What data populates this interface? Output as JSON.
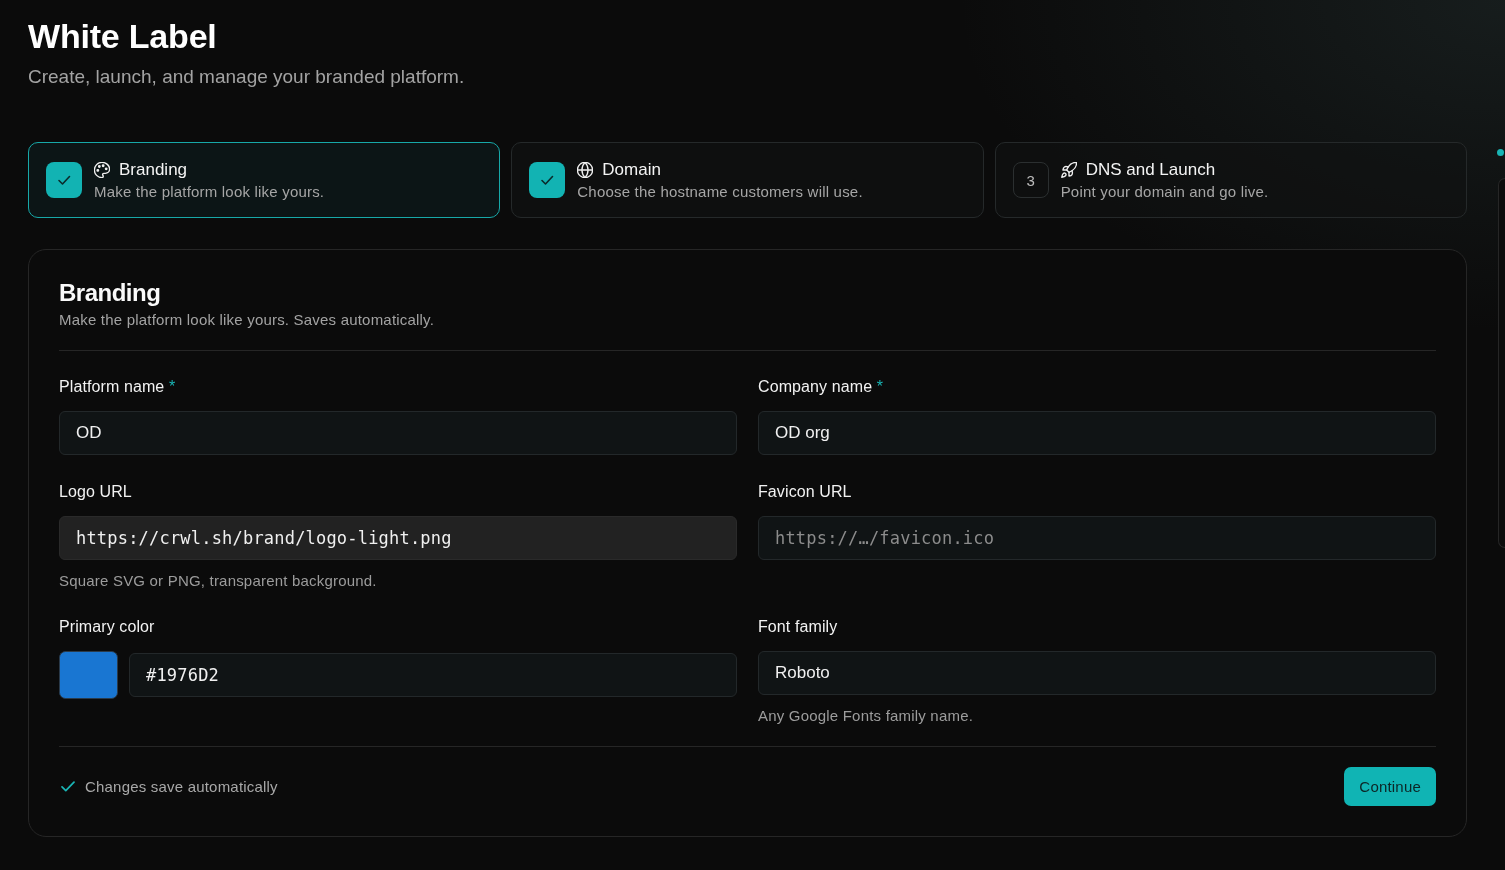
{
  "header": {
    "title": "White Label",
    "subtitle": "Create, launch, and manage your branded platform."
  },
  "steps": [
    {
      "title": "Branding",
      "description": "Make the platform look like yours.",
      "selected": true,
      "completed": true
    },
    {
      "title": "Domain",
      "description": "Choose the hostname customers will use.",
      "selected": false,
      "completed": true
    },
    {
      "number": "3",
      "title": "DNS and Launch",
      "description": "Point your domain and go live.",
      "selected": false,
      "completed": false
    }
  ],
  "form": {
    "title": "Branding",
    "description": "Make the platform look like yours. Saves automatically.",
    "fields": [
      {
        "kind": "text",
        "label": "Platform name",
        "required_mark": "*",
        "value": "OD",
        "hovered": false
      },
      {
        "kind": "text",
        "label": "Company name",
        "required_mark": "*",
        "value": "OD org",
        "hovered": false
      },
      {
        "kind": "url",
        "label": "Logo URL",
        "value": "https://crwl.sh/brand/logo-light.png",
        "hint": "Square SVG or PNG, transparent background.",
        "hovered": true
      },
      {
        "kind": "url",
        "label": "Favicon URL",
        "placeholder": "https://…/favicon.ico",
        "hovered": false
      },
      {
        "kind": "color",
        "label": "Primary color",
        "color": "#1976d2",
        "value": "#1976D2",
        "hovered": false
      },
      {
        "kind": "text",
        "label": "Font family",
        "value": "Roboto",
        "hint": "Any Google Fonts family name.",
        "hovered": false
      }
    ],
    "footer": {
      "status": "Changes save automatically",
      "button": "Continue"
    }
  }
}
